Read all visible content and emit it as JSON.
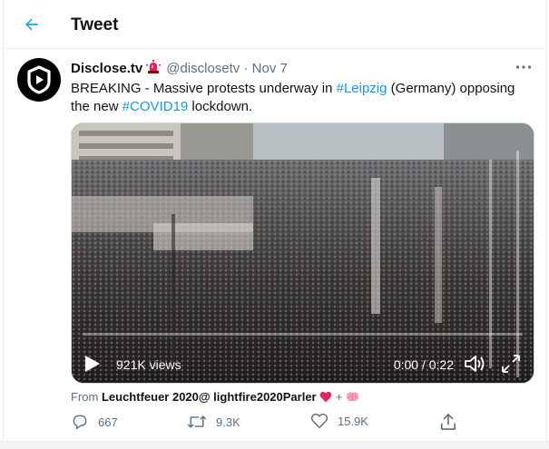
{
  "header": {
    "title": "Tweet",
    "back_icon": "arrow-left-icon",
    "accent": "#1da1f2"
  },
  "tweet": {
    "author": {
      "display_name": "Disclose.tv",
      "badge_icon": "police-light-emoji",
      "handle": "@disclosetv",
      "separator": "·",
      "date": "Nov 7",
      "avatar_icon": "play-shield-logo"
    },
    "more_icon": "more-horizontal-icon",
    "text": {
      "part1": "BREAKING - Massive protests underway in ",
      "hashtag1": "#Leipzig",
      "part2": " (Germany) opposing the new ",
      "hashtag2": "#COVID19",
      "part3": " lockdown."
    },
    "video": {
      "views": "921K views",
      "time": "0:00 / 0:22",
      "progress": 0
    },
    "source": {
      "prefix": "From ",
      "name": "Leuchtfeuer 2020@ lightfire2020Parler",
      "suffix": " + "
    },
    "actions": {
      "replies": "667",
      "retweets": "9.3K",
      "likes": "15.9K"
    }
  }
}
